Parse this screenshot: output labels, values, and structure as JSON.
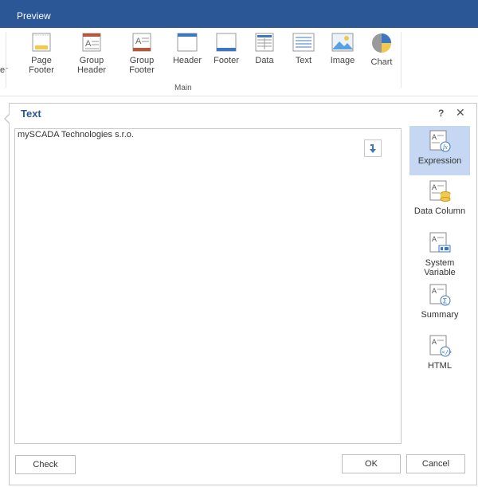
{
  "topbar": {
    "title": "Preview"
  },
  "ribbon": {
    "cut_label": "er",
    "group_label": "Main",
    "items": [
      {
        "label": "Page Footer",
        "l1": "Page",
        "l2": "Footer"
      },
      {
        "label": "Group Header",
        "l1": "Group",
        "l2": "Header"
      },
      {
        "label": "Group Footer",
        "l1": "Group",
        "l2": "Footer"
      },
      {
        "label": "Header",
        "l1": "Header",
        "l2": ""
      },
      {
        "label": "Footer",
        "l1": "Footer",
        "l2": ""
      },
      {
        "label": "Data",
        "l1": "Data",
        "l2": ""
      },
      {
        "label": "Text",
        "l1": "Text",
        "l2": ""
      },
      {
        "label": "Image",
        "l1": "Image",
        "l2": ""
      },
      {
        "label": "Chart",
        "l1": "Chart",
        "l2": ""
      }
    ]
  },
  "dialog": {
    "title": "Text",
    "help": "?",
    "close": "✕",
    "editor_text": "mySCADA Technologies s.r.o.",
    "side": [
      {
        "l1": "Expression",
        "l2": ""
      },
      {
        "l1": "Data Column",
        "l2": ""
      },
      {
        "l1": "System",
        "l2": "Variable"
      },
      {
        "l1": "Summary",
        "l2": ""
      },
      {
        "l1": "HTML",
        "l2": ""
      }
    ],
    "buttons": {
      "check": "Check",
      "ok": "OK",
      "cancel": "Cancel"
    }
  },
  "colors": {
    "brand": "#2b5797",
    "active": "#c5d7f2"
  }
}
